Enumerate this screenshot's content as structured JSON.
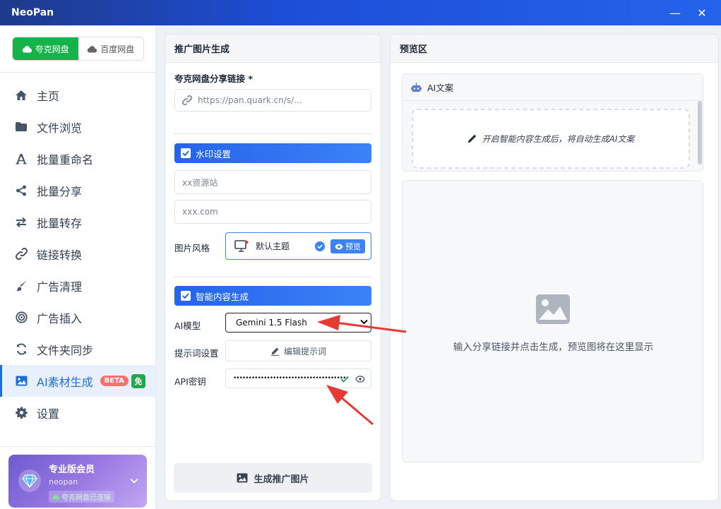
{
  "window": {
    "title": "NeoPan",
    "minimize": "—",
    "close": "✕"
  },
  "drive_switch": {
    "quark_label": "夸克网盘",
    "baidu_label": "百度网盘",
    "active": "quark"
  },
  "nav": {
    "items": [
      {
        "label": "主页",
        "icon": "home-icon"
      },
      {
        "label": "文件浏览",
        "icon": "folder-icon"
      },
      {
        "label": "批量重命名",
        "icon": "font-icon"
      },
      {
        "label": "批量分享",
        "icon": "share-icon"
      },
      {
        "label": "批量转存",
        "icon": "transfer-icon"
      },
      {
        "label": "链接转换",
        "icon": "link-icon"
      },
      {
        "label": "广告清理",
        "icon": "brush-icon"
      },
      {
        "label": "广告插入",
        "icon": "target-icon"
      },
      {
        "label": "文件夹同步",
        "icon": "sync-icon"
      },
      {
        "label": "AI素材生成",
        "icon": "image-icon",
        "active": true,
        "badge_beta": "BETA",
        "badge_free": "免"
      },
      {
        "label": "设置",
        "icon": "gear-icon"
      }
    ]
  },
  "member": {
    "title": "专业版会员",
    "username": "neopan",
    "status": "夸克网盘已连接"
  },
  "form": {
    "header": "推广图片生成",
    "share_link_label": "夸克网盘分享链接 *",
    "share_link_placeholder": "https://pan.quark.cn/s/...",
    "watermark_section": "水印设置",
    "watermark_text_placeholder": "xx资源站",
    "watermark_url_placeholder": "xxx.com",
    "style_label": "图片风格",
    "theme_name": "默认主题",
    "preview_btn": "预览",
    "ai_section": "智能内容生成",
    "model_label": "AI模型",
    "model_value": "Gemini 1.5 Flash",
    "prompt_label": "提示词设置",
    "edit_prompt_btn": "编辑提示词",
    "api_key_label": "API密钥",
    "api_key_masked": "••••••••••••••••••••••••••••••••••••••",
    "generate_btn": "生成推广图片"
  },
  "preview": {
    "header": "预览区",
    "ai_copy_title": "AI文案",
    "ai_copy_hint": "开启智能内容生成后，将自动生成AI文案",
    "placeholder_text": "输入分享链接并点击生成，预览图将在这里显示"
  },
  "colors": {
    "accent_blue": "#2563eb",
    "quark_green": "#16b34a",
    "annotation_red": "#e53935"
  }
}
